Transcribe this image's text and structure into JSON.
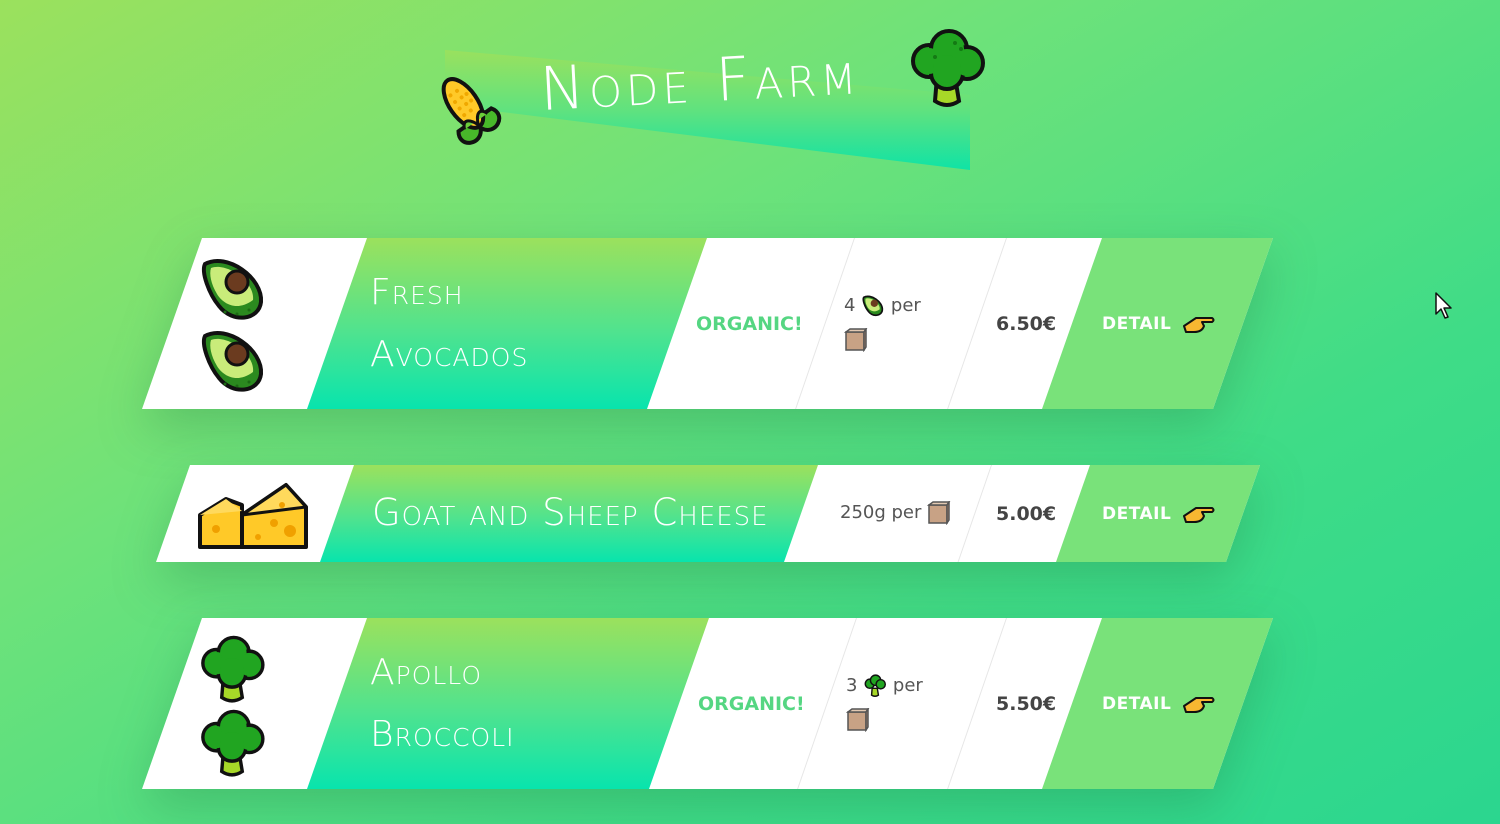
{
  "header": {
    "title": "Node Farm"
  },
  "products": [
    {
      "name_line1": "Fresh",
      "name_line2": "Avocados",
      "organic_label": "ORGANIC!",
      "quantity_count": "4",
      "quantity_per": "per",
      "price": "6.50€",
      "detail_label": "DETAIL",
      "icon": "avocado-icon"
    },
    {
      "name": "Goat and Sheep Cheese",
      "quantity": "250g per",
      "price": "5.00€",
      "detail_label": "DETAIL",
      "icon": "cheese-icon"
    },
    {
      "name_line1": "Apollo",
      "name_line2": "Broccoli",
      "organic_label": "ORGANIC!",
      "quantity_count": "3",
      "quantity_per": "per",
      "price": "5.50€",
      "detail_label": "DETAIL",
      "icon": "broccoli-icon"
    }
  ],
  "colors": {
    "background_start": "#9be15d",
    "background_end": "#2bd68f",
    "card_white": "#ffffff",
    "detail_green": "#79e27a",
    "organic_text": "#55d682",
    "price_text": "#444444"
  }
}
